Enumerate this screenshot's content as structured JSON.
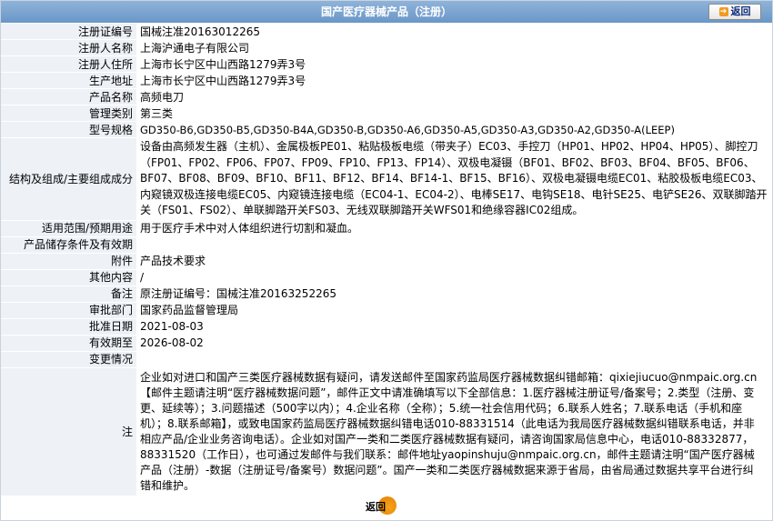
{
  "header": {
    "title": "国产医疗器械产品（注册）",
    "back_label": "返回"
  },
  "rows": [
    {
      "label": "注册证编号",
      "value": "国械注准20163012265"
    },
    {
      "label": "注册人名称",
      "value": "上海沪通电子有限公司"
    },
    {
      "label": "注册人住所",
      "value": "上海市长宁区中山西路1279弄3号"
    },
    {
      "label": "生产地址",
      "value": "上海市长宁区中山西路1279弄3号"
    },
    {
      "label": "产品名称",
      "value": "高频电刀"
    },
    {
      "label": "管理类别",
      "value": "第三类"
    },
    {
      "label": "型号规格",
      "value": "GD350-B6,GD350-B5,GD350-B4A,GD350-B,GD350-A6,GD350-A5,GD350-A3,GD350-A2,GD350-A(LEEP)"
    },
    {
      "label": "结构及组成/主要组成成分",
      "value": "设备由高频发生器（主机）、金属极板PE01、粘贴极板电缆（带夹子）EC03、手控刀（HP01、HP02、HP04、HP05）、脚控刀（FP01、FP02、FP06、FP07、FP09、FP10、FP13、FP14）、双极电凝镊（BF01、BF02、BF03、BF04、BF05、BF06、BF07、BF08、BF09、BF10、BF11、BF12、BF14、BF14-1、BF15、BF16）、双极电凝镊电缆EC01、粘胶极板电缆EC03、内窥镜双极连接电缆EC05、内窥镜连接电缆（EC04-1、EC04-2）、电棒SE17、电钩SE18、电针SE25、电铲SE26、双联脚踏开关（FS01、FS02）、单联脚踏开关FS03、无线双联脚踏开关WFS01和绝缘容器IC02组成。"
    },
    {
      "label": "适用范围/预期用途",
      "value": "用于医疗手术中对人体组织进行切割和凝血。"
    },
    {
      "label": "产品储存条件及有效期",
      "value": ""
    },
    {
      "label": "附件",
      "value": "产品技术要求"
    },
    {
      "label": "其他内容",
      "value": "/"
    },
    {
      "label": "备注",
      "value": "原注册证编号：国械注准20163252265"
    },
    {
      "label": "审批部门",
      "value": "国家药品监督管理局"
    },
    {
      "label": "批准日期",
      "value": "2021-08-03"
    },
    {
      "label": "有效期至",
      "value": "2026-08-02"
    },
    {
      "label": "变更情况",
      "value": ""
    }
  ],
  "note": {
    "label": "注",
    "text": "企业如对进口和国产三类医疗器械数据有疑问，请发送邮件至国家药监局医疗器械数据纠错邮箱：qixiejiucuo@nmpaic.org.cn【邮件主题请注明“医疗器械数据问题”，邮件正文中请准确填写以下全部信息：1.医疗器械注册证号/备案号；2.类型（注册、变更、延续等）；3.问题描述（500字以内）；4.企业名称（全称）；5.统一社会信用代码；6.联系人姓名；7.联系电话（手机和座机）；8.联系邮箱】，或致电国家药监局医疗器械数据纠错电话010-88331514（此电话为我局医疗器械数据纠错联系电话，并非相应产品/企业业务咨询电话）。企业如对国产一类和二类医疗器械数据有疑问，请咨询国家局信息中心，电话010-88332877，88331520（工作日），也可通过发邮件与我们联系：邮件地址yaopinshuju@nmpaic.org.cn，邮件主题请注明“国产医疗器械产品（注册）-数据（注册证号/备案号）数据问题”。国产一类和二类医疗器械数据来源于省局，由省局通过数据共享平台进行纠错和维护。"
  },
  "footer": {
    "back_label": "返回"
  },
  "colors": {
    "title_bar": "#7aa4d0",
    "label_bg": "#eef2f7",
    "back_icon": "#f29a1e"
  }
}
